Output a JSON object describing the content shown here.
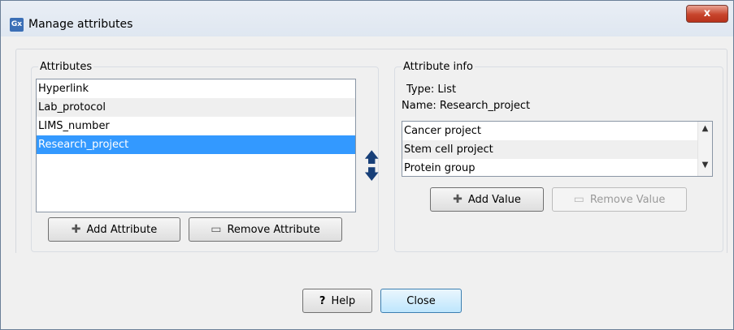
{
  "window": {
    "title": "Manage attributes",
    "icon_text": "Gx",
    "close_symbol": "x"
  },
  "attributes": {
    "group_label": "Attributes",
    "items": [
      "Hyperlink",
      "Lab_protocol",
      "LIMS_number",
      "Research_project"
    ],
    "add_label": "Add Attribute",
    "remove_label": "Remove Attribute"
  },
  "attribute_info": {
    "group_label": "Attribute info",
    "type_label": "Type:",
    "type_value": "List",
    "name_label": "Name:",
    "name_value": "Research_project",
    "values": [
      "Cancer project",
      "Stem cell project",
      "Protein group"
    ],
    "add_value_label": "Add Value",
    "remove_value_label": "Remove Value"
  },
  "footer": {
    "help_symbol": "?",
    "help_label": "Help",
    "close_label": "Close"
  },
  "icons": {
    "move_up": "arrow-up-icon",
    "move_down": "arrow-down-icon",
    "add": "plus-icon",
    "remove": "minus-icon",
    "scroll_up": "scroll-up-icon",
    "scroll_down": "scroll-down-icon"
  }
}
